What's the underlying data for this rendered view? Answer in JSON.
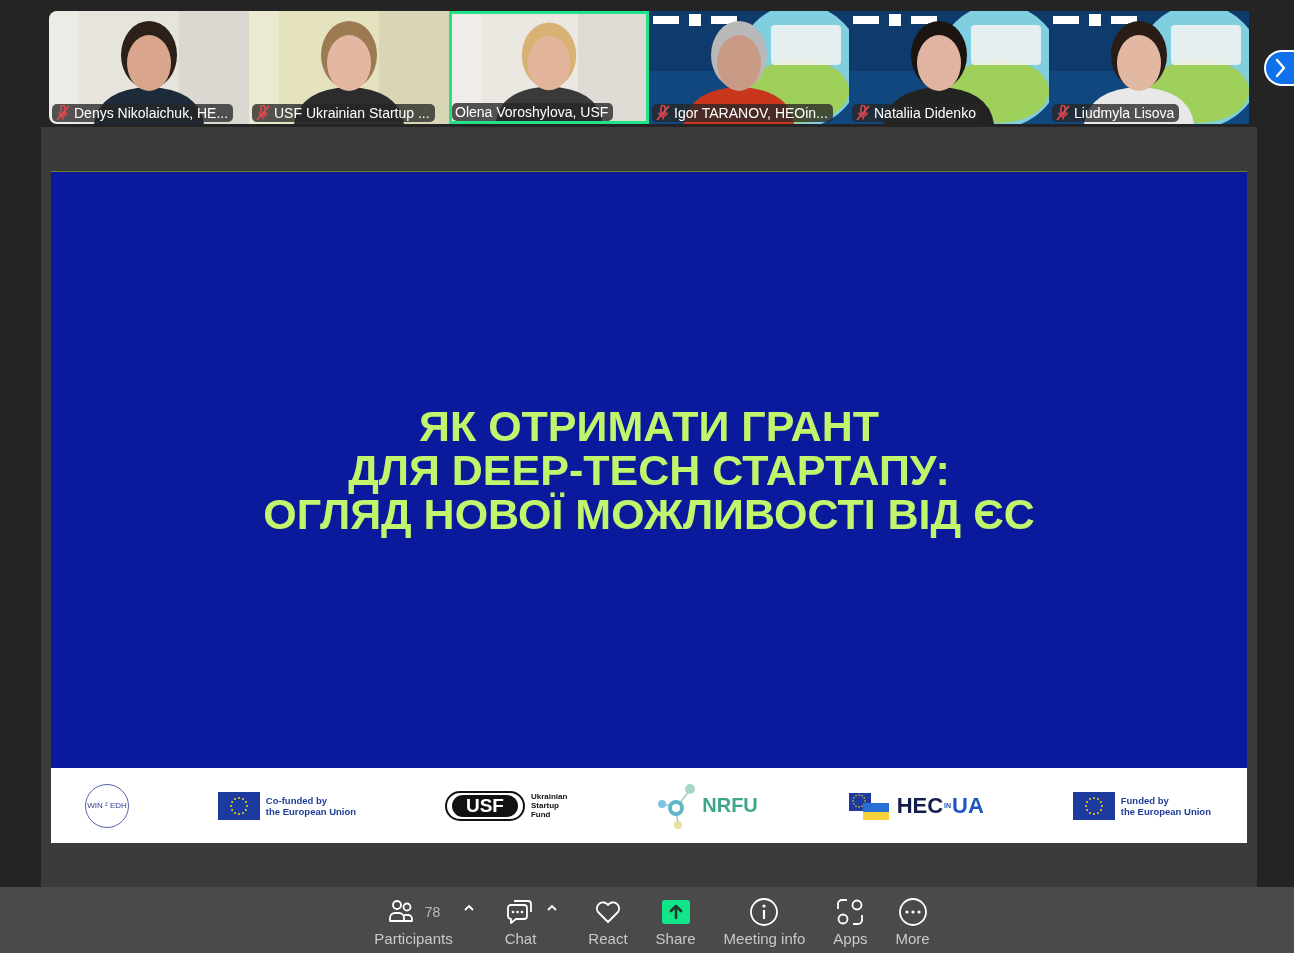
{
  "participants": [
    {
      "name": "Denys Nikolaichuk, HE...",
      "muted": true,
      "speaking": false,
      "kind": "picture"
    },
    {
      "name": "USF Ukrainian Startup ...",
      "muted": true,
      "speaking": false,
      "kind": "picture"
    },
    {
      "name": "Olena Voroshylova, USF",
      "muted": false,
      "speaking": true,
      "kind": "picture"
    },
    {
      "name": "Igor TARANOV, HEOin...",
      "muted": true,
      "speaking": false,
      "kind": "picture"
    },
    {
      "name": "Nataliia Didenko",
      "muted": true,
      "speaking": false,
      "kind": "picture"
    },
    {
      "name": "Liudmyla Lisova",
      "muted": true,
      "speaking": false,
      "kind": "picture"
    }
  ],
  "shared_slide": {
    "title_lines": [
      "ЯК ОТРИМАТИ ГРАНТ",
      "ДЛЯ DEEP-TECH СТАРТАПУ:",
      "ОГЛЯД НОВОЇ МОЖЛИВОСТІ ВІД ЄС"
    ],
    "logos": [
      {
        "kind": "circle",
        "text": "WIN ² EDH"
      },
      {
        "kind": "eu",
        "text": "Co-funded by\nthe European Union"
      },
      {
        "kind": "usf",
        "mark": "USF",
        "text": "Ukrainian\nStartup\nFund"
      },
      {
        "kind": "nrfu",
        "text": "NRFU"
      },
      {
        "kind": "heoua",
        "parts": [
          "HEC",
          "IN",
          "UA"
        ]
      },
      {
        "kind": "eu",
        "text": "Funded by\nthe European Union"
      }
    ]
  },
  "toolbar": [
    {
      "kind": "participants",
      "label": "Participants",
      "count": "78",
      "menu": true
    },
    {
      "kind": "chat",
      "label": "Chat",
      "menu": true
    },
    {
      "kind": "react",
      "label": "React",
      "menu": false
    },
    {
      "kind": "share",
      "label": "Share",
      "menu": false
    },
    {
      "kind": "info",
      "label": "Meeting info",
      "menu": false
    },
    {
      "kind": "apps",
      "label": "Apps",
      "menu": false
    },
    {
      "kind": "more",
      "label": "More",
      "menu": false
    }
  ]
}
